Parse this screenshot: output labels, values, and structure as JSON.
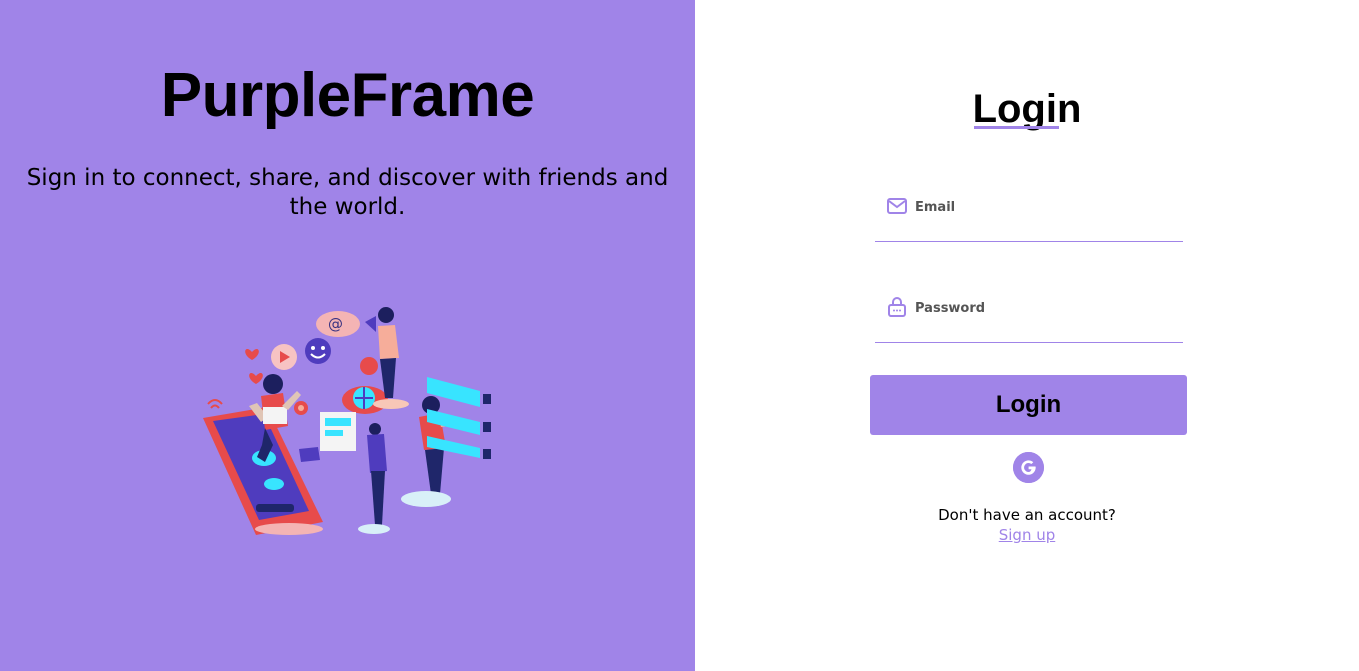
{
  "left_panel": {
    "title": "PurpleFrame",
    "tagline": "Sign in to connect, share, and discover with friends and the world."
  },
  "login_form": {
    "title": "Login",
    "email_placeholder": "Email",
    "password_placeholder": "Password",
    "submit_label": "Login",
    "google_icon": "google-icon",
    "signup_prompt": "Don't have an account?",
    "signup_link": "Sign up"
  },
  "colors": {
    "accent": "#a084e8",
    "background": "#ffffff",
    "text": "#000000"
  },
  "icons": {
    "email": "envelope-icon",
    "password": "lock-icon",
    "social": "google-icon"
  }
}
